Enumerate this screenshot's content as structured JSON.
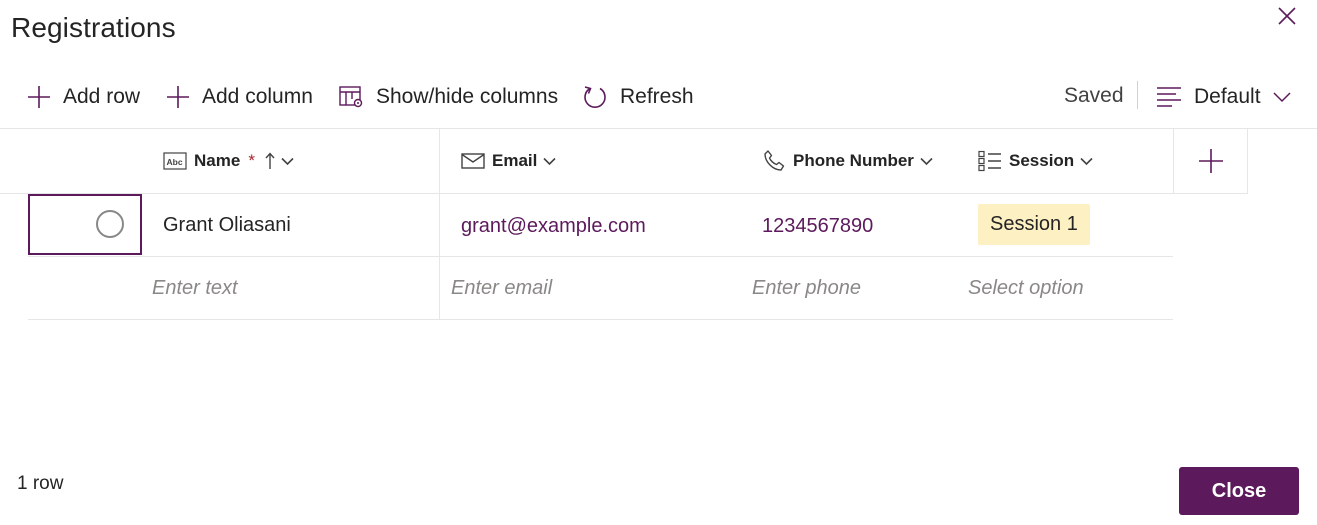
{
  "dialog": {
    "title": "Registrations",
    "close_icon": "close-icon"
  },
  "toolbar": {
    "add_row": "Add row",
    "add_column": "Add column",
    "show_hide_columns": "Show/hide columns",
    "refresh": "Refresh",
    "status": "Saved",
    "view": "Default"
  },
  "columns": [
    {
      "label": "Name",
      "icon": "text-field-icon",
      "required": "*",
      "sorted": "ascending"
    },
    {
      "label": "Email",
      "icon": "mail-icon"
    },
    {
      "label": "Phone Number",
      "icon": "phone-icon"
    },
    {
      "label": "Session",
      "icon": "choice-list-icon"
    }
  ],
  "rows": [
    {
      "name": "Grant Oliasani",
      "email": "grant@example.com",
      "phone": "1234567890",
      "session": "Session 1"
    }
  ],
  "new_row": {
    "name_placeholder": "Enter text",
    "email_placeholder": "Enter email",
    "phone_placeholder": "Enter phone",
    "session_placeholder": "Select option"
  },
  "footer": {
    "row_count": "1 row",
    "close": "Close"
  },
  "colors": {
    "accent": "#5c1a5c",
    "badge_bg": "#fdf0c2",
    "required": "#a4262c"
  }
}
